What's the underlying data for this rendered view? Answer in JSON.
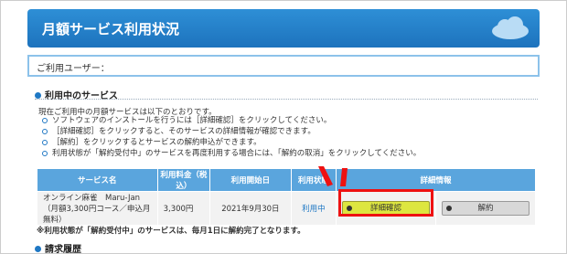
{
  "header": {
    "title": "月額サービス利用状況"
  },
  "user": {
    "label": "ご利用ユーザー："
  },
  "sections": {
    "in_use": "利用中のサービス",
    "billing": "請求履歴"
  },
  "intro": "現在ご利用中の月額サービスは以下のとおりです。",
  "bullets": [
    "ソフトウェアのインストールを行うには［詳細確認］をクリックしてください。",
    "［詳細確認］をクリックすると、そのサービスの詳細情報が確認できます。",
    "［解約］をクリックするとサービスの解約申込ができます。",
    "利用状態が「解約受付中」のサービスを再度利用する場合には、「解約の取消」をクリックしてください。"
  ],
  "table": {
    "headers": [
      "サービス名",
      "利用料金（税込）",
      "利用開始日",
      "利用状態",
      "詳細情報"
    ],
    "row": {
      "service": "オンライン麻雀　Maru-Jan（月額3,300円コース／申込月無料）",
      "fee": "3,300円",
      "start": "2021年9月30日",
      "status": "利用中",
      "detail_btn": "詳細確認",
      "cancel_btn": "解約"
    }
  },
  "note": "※利用状態が「解約受付中」のサービスは、毎月1日に解約完了となります。",
  "colors": {
    "header": "#1d73bd",
    "th": "#5aa5dd",
    "detail": "#dde640",
    "highlight": "#e11111"
  }
}
